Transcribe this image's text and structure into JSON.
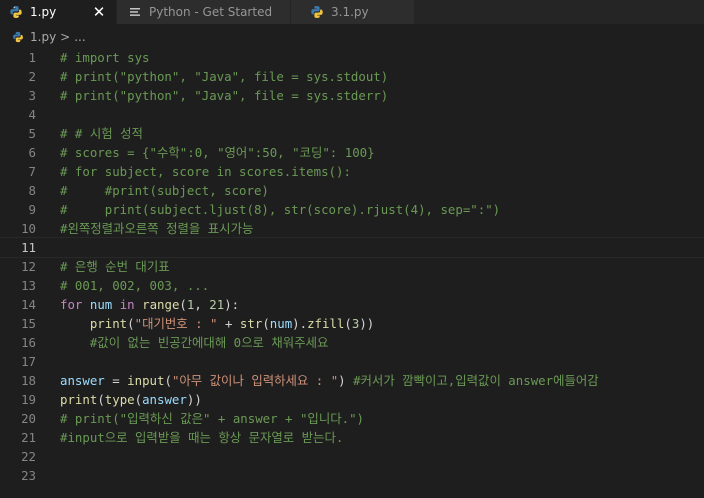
{
  "tabs": [
    {
      "label": "1.py",
      "active": true,
      "close": "✕"
    },
    {
      "label": "Python - Get Started",
      "active": false
    },
    {
      "label": "3.1.py",
      "active": false
    }
  ],
  "breadcrumb": {
    "file": "1.py",
    "separator": ">",
    "rest": "..."
  },
  "lines": [
    {
      "n": "1",
      "text": "# import sys"
    },
    {
      "n": "2",
      "text": "# print(\"python\", \"Java\", file = sys.stdout)"
    },
    {
      "n": "3",
      "text": "# print(\"python\", \"Java\", file = sys.stderr)"
    },
    {
      "n": "4",
      "text": ""
    },
    {
      "n": "5",
      "text": "# # 시험 성적"
    },
    {
      "n": "6",
      "text": "# scores = {\"수학\":0, \"영어\":50, \"코딩\": 100}"
    },
    {
      "n": "7",
      "text": "# for subject, score in scores.items():"
    },
    {
      "n": "8",
      "text": "#     #print(subject, score)"
    },
    {
      "n": "9",
      "text": "#     print(subject.ljust(8), str(score).rjust(4), sep=\":\")"
    },
    {
      "n": "10",
      "text": "#왼쪽정렬과오른쪽 정렬을 표시가능"
    },
    {
      "n": "11",
      "text": ""
    },
    {
      "n": "12",
      "text": "# 은행 순번 대기표"
    },
    {
      "n": "13",
      "text": "# 001, 002, 003, ..."
    },
    {
      "n": "14",
      "text": "for num in range(1, 21):"
    },
    {
      "n": "15",
      "text": "    print(\"대기번호 : \" + str(num).zfill(3))"
    },
    {
      "n": "16",
      "text": "    #값이 없는 빈공간에대해 0으로 채워주세요"
    },
    {
      "n": "17",
      "text": ""
    },
    {
      "n": "18",
      "text": "answer = input(\"아무 값이나 입력하세요 : \") #커서가 깜빡이고,입력값이 answer에들어감"
    },
    {
      "n": "19",
      "text": "print(type(answer))"
    },
    {
      "n": "20",
      "text": "# print(\"입력하신 값은\" + answer + \"입니다.\")"
    },
    {
      "n": "21",
      "text": "#input으로 입력받을 때는 항상 문자열로 받는다."
    },
    {
      "n": "22",
      "text": ""
    },
    {
      "n": "23",
      "text": ""
    }
  ],
  "current_line": "11",
  "colors": {
    "comment": "#6a9955",
    "keyword": "#c586c0",
    "variable": "#9cdcfe",
    "function": "#dcdcaa",
    "number": "#b5cea8",
    "string": "#ce9178",
    "background": "#1e1e1e"
  },
  "icons": {
    "python_file": "python-icon",
    "info_file": "info-icon"
  }
}
